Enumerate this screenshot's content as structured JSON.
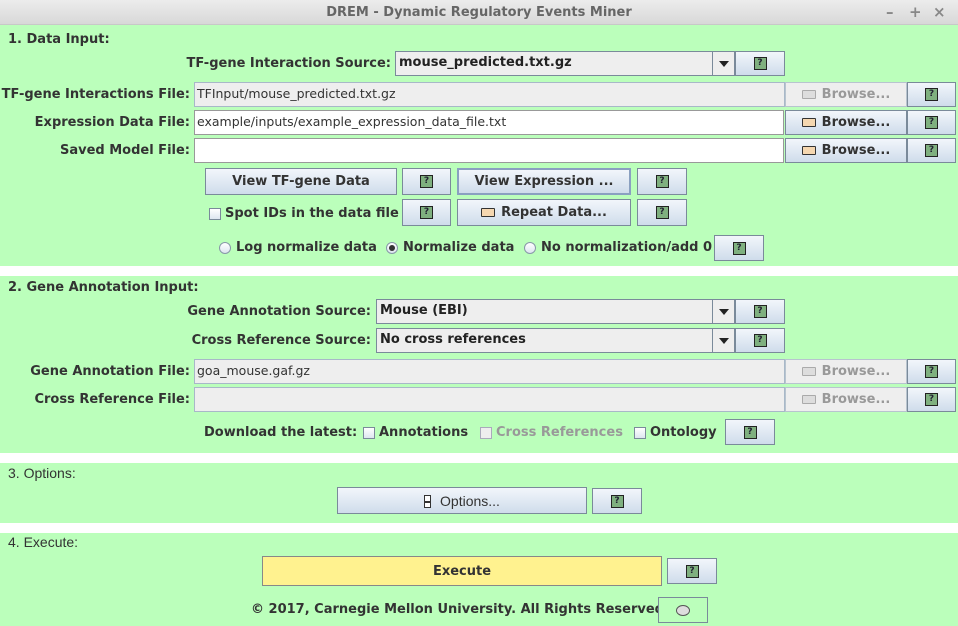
{
  "window": {
    "title": "DREM - Dynamic Regulatory Events Miner",
    "controls": {
      "minimize": "–",
      "maximize": "+",
      "close": "×"
    }
  },
  "sections": {
    "data_input": {
      "title": "1.  Data Input:",
      "tf_source_label": "TF-gene Interaction Source:",
      "tf_source_value": "mouse_predicted.txt.gz",
      "tf_file_label": "TF-gene Interactions File:",
      "tf_file_value": "TFInput/mouse_predicted.txt.gz",
      "expr_file_label": "Expression Data File:",
      "expr_file_value": "example/inputs/example_expression_data_file.txt",
      "saved_model_label": "Saved Model File:",
      "saved_model_value": "",
      "browse_label": "Browse...",
      "view_tf_label": "View TF-gene Data",
      "view_expr_label": "View Expression ...",
      "spot_ids_label": "Spot IDs in the data file",
      "spot_ids_checked": false,
      "repeat_data_label": "Repeat Data...",
      "normalization": {
        "options": [
          "Log normalize data",
          "Normalize data",
          "No normalization/add 0"
        ],
        "selected": "Normalize data"
      }
    },
    "gene_annotation": {
      "title": "2.  Gene Annotation Input:",
      "annotation_source_label": "Gene Annotation Source:",
      "annotation_source_value": "Mouse (EBI)",
      "crossref_source_label": "Cross Reference Source:",
      "crossref_source_value": "No cross references",
      "annotation_file_label": "Gene Annotation File:",
      "annotation_file_value": "goa_mouse.gaf.gz",
      "crossref_file_label": "Cross Reference File:",
      "crossref_file_value": "",
      "download_label": "Download the latest:",
      "download_options": [
        {
          "label": "Annotations",
          "checked": false,
          "enabled": true
        },
        {
          "label": "Cross References",
          "checked": false,
          "enabled": false
        },
        {
          "label": "Ontology",
          "checked": false,
          "enabled": true
        }
      ]
    },
    "options": {
      "title": "3.  Options:",
      "options_button_label": "Options..."
    },
    "execute": {
      "title": "4.  Execute:",
      "execute_button_label": "Execute",
      "copyright": "© 2017, Carnegie Mellon University.  All Rights Reserved."
    }
  },
  "help_glyph": "?",
  "colors": {
    "panel_bg": "#bbffbb",
    "execute_bg": "#fff28f",
    "separator": "#ffffff"
  }
}
